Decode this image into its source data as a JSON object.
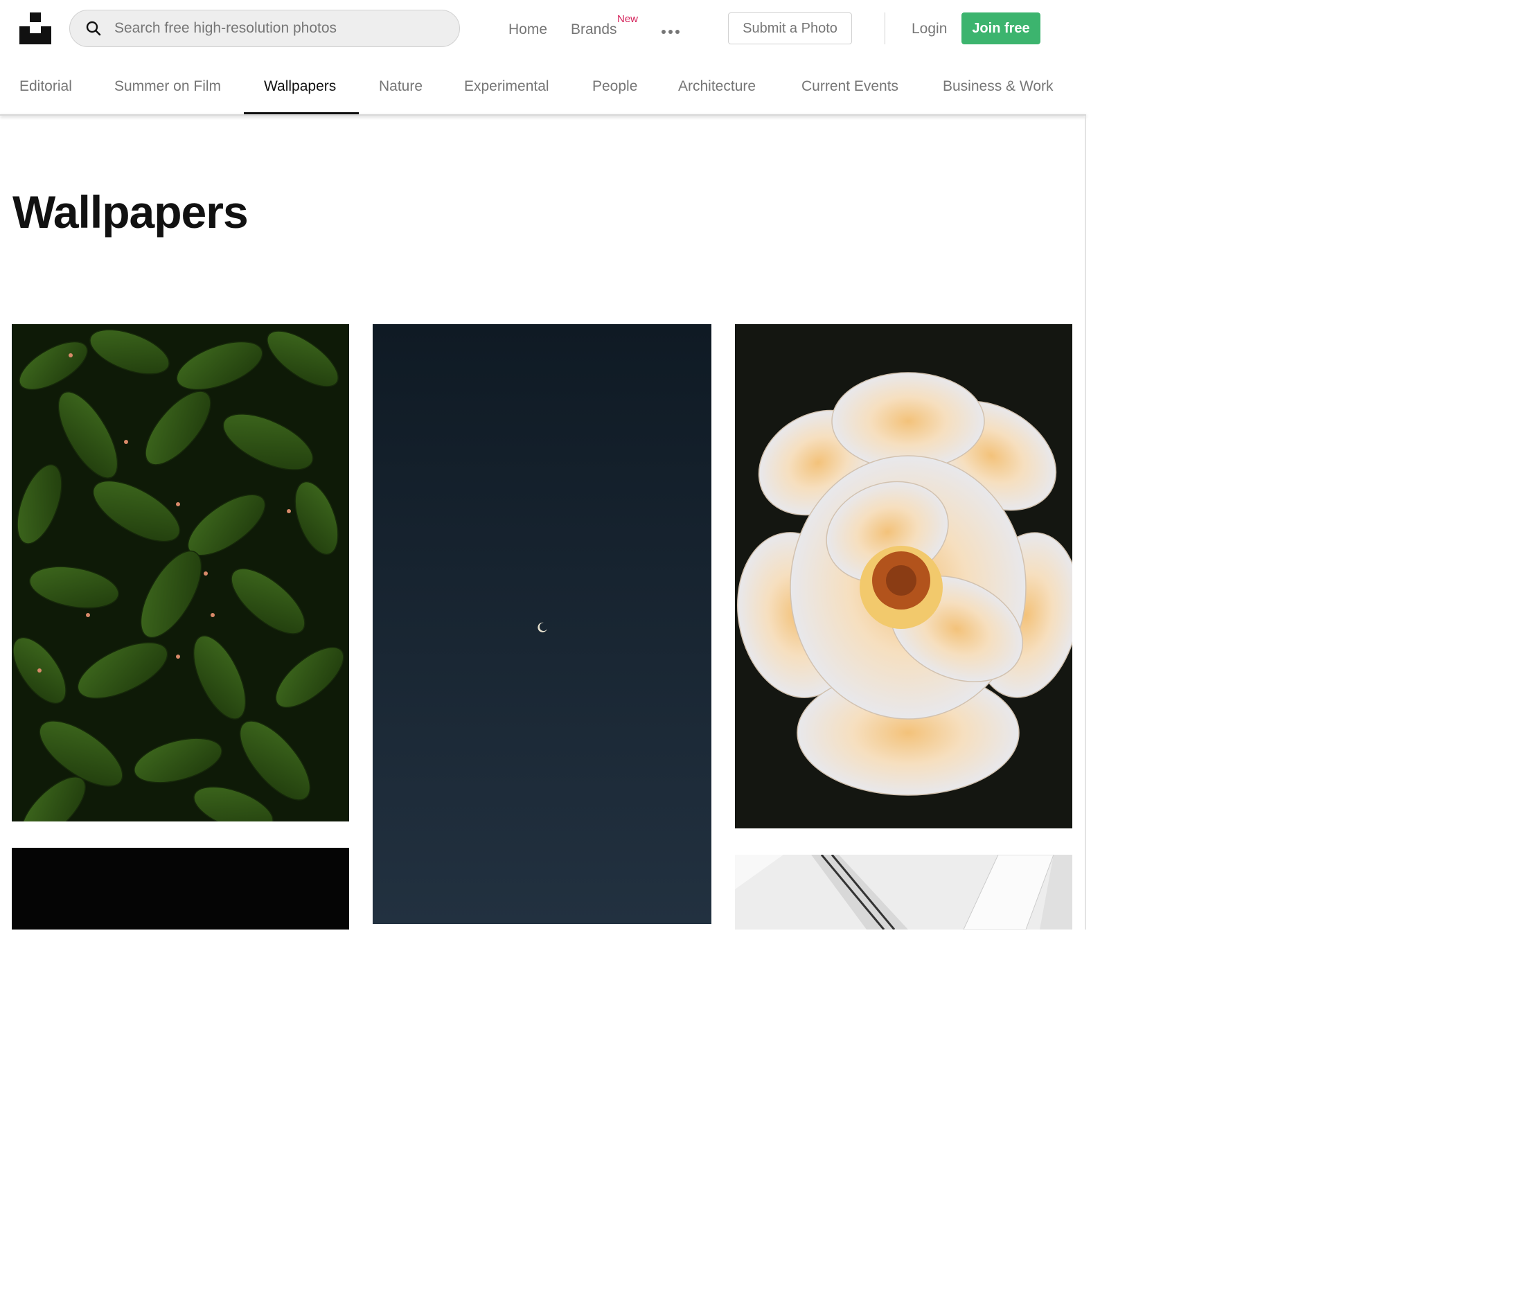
{
  "header": {
    "search_placeholder": "Search free high-resolution photos",
    "nav": {
      "home": "Home",
      "brands": "Brands",
      "brands_badge": "New"
    },
    "submit_label": "Submit a Photo",
    "login_label": "Login",
    "join_label": "Join free"
  },
  "topics": [
    "Editorial",
    "Summer on Film",
    "Wallpapers",
    "Nature",
    "Experimental",
    "People",
    "Architecture",
    "Current Events",
    "Business & Work"
  ],
  "active_topic": "Wallpapers",
  "page": {
    "title": "Wallpapers"
  },
  "colors": {
    "accent_green": "#3cb46e",
    "badge_pink": "#d4225a",
    "muted_text": "#767676"
  },
  "photos": [
    {
      "subject": "green leaves"
    },
    {
      "subject": "crescent moon in night sky"
    },
    {
      "subject": "white and peach rose"
    },
    {
      "subject": "dark night"
    },
    {
      "subject": "white architecture"
    }
  ]
}
